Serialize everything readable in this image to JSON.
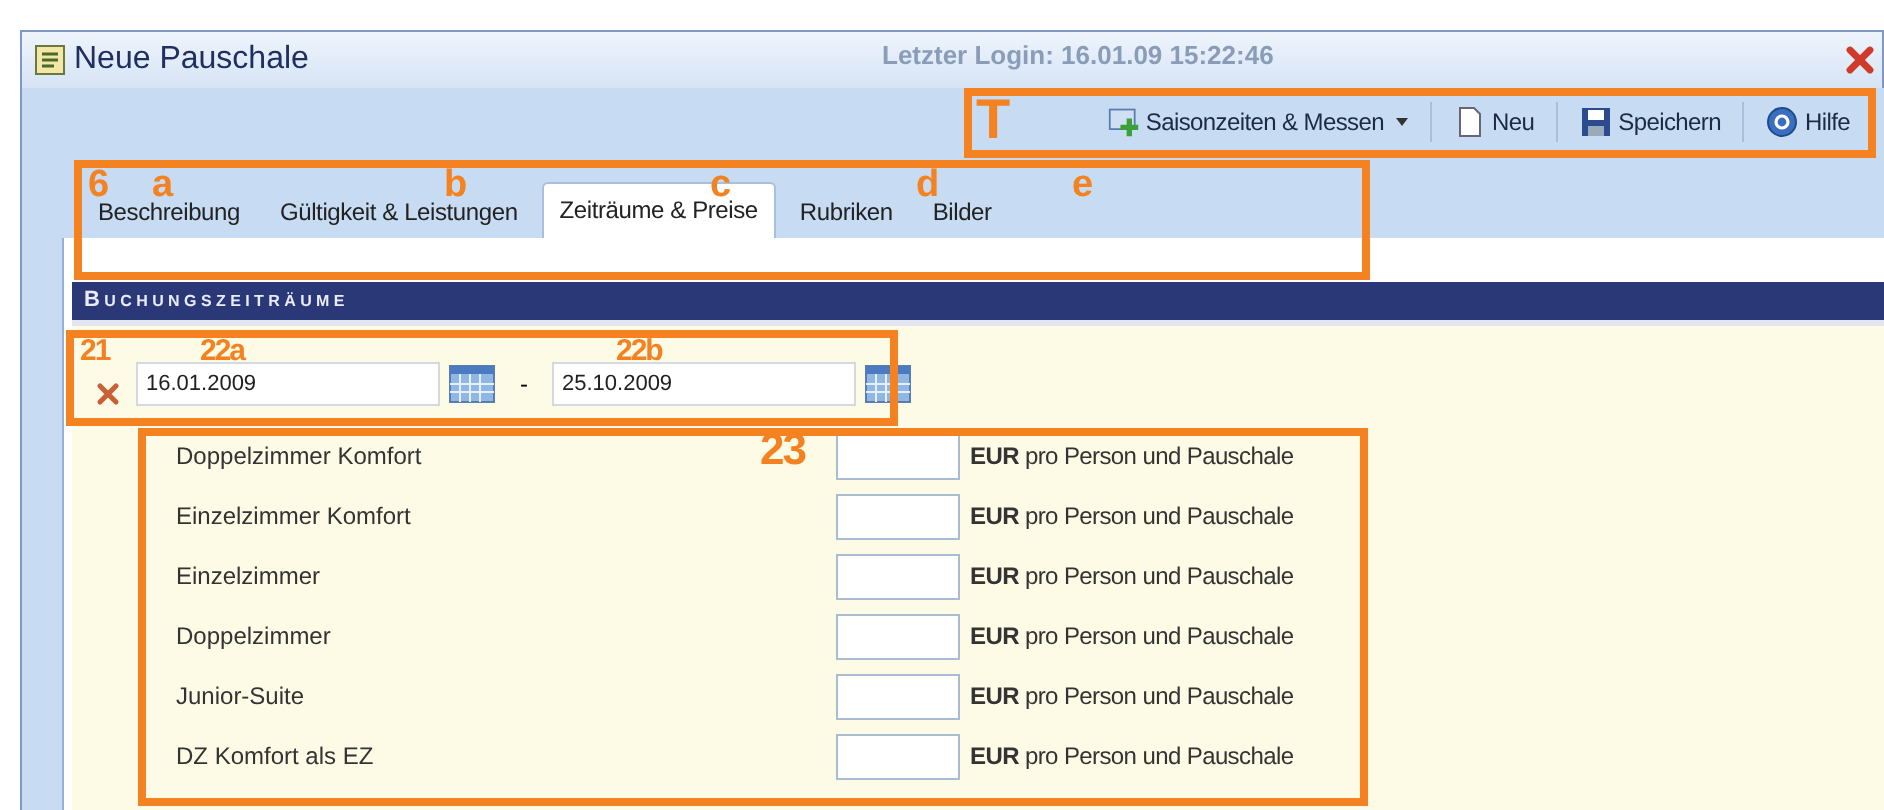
{
  "window": {
    "title": "Neue Pauschale",
    "background_text": "Letzter Login: 16.01.09 15:22:46"
  },
  "toolbar": [
    {
      "label": "Saisonzeiten & Messen",
      "kind": "dropdown"
    },
    {
      "label": "Neu",
      "kind": "new"
    },
    {
      "label": "Speichern",
      "kind": "save"
    },
    {
      "label": "Hilfe",
      "kind": "help"
    }
  ],
  "tabs": [
    {
      "label": "Beschreibung",
      "selected": false
    },
    {
      "label": "Gültigkeit & Leistungen",
      "selected": false
    },
    {
      "label": "Zeiträume & Preise",
      "selected": true
    },
    {
      "label": "Rubriken",
      "selected": false
    },
    {
      "label": "Bilder",
      "selected": false
    }
  ],
  "section": {
    "title": "Buchungszeiträume",
    "from": "16.01.2009",
    "separator": "-",
    "to": "25.10.2009"
  },
  "rows": [
    {
      "name": "Doppelzimmer Komfort",
      "unit": "**EUR** pro Person und Pauschale"
    },
    {
      "name": "Einzelzimmer Komfort",
      "unit": "**EUR** pro Person und Pauschale"
    },
    {
      "name": "Einzelzimmer",
      "unit": "**EUR** pro Person und Pauschale"
    },
    {
      "name": "Doppelzimmer",
      "unit": "**EUR** pro Person und Pauschale"
    },
    {
      "name": "Junior-Suite",
      "unit": "**EUR** pro Person und Pauschale"
    },
    {
      "name": "DZ Komfort als EZ",
      "unit": "**EUR** pro Person und Pauschale"
    }
  ],
  "annotations": [
    "T",
    "6",
    "a",
    "b",
    "c",
    "d",
    "e",
    "21",
    "22a",
    "22b",
    "23"
  ]
}
